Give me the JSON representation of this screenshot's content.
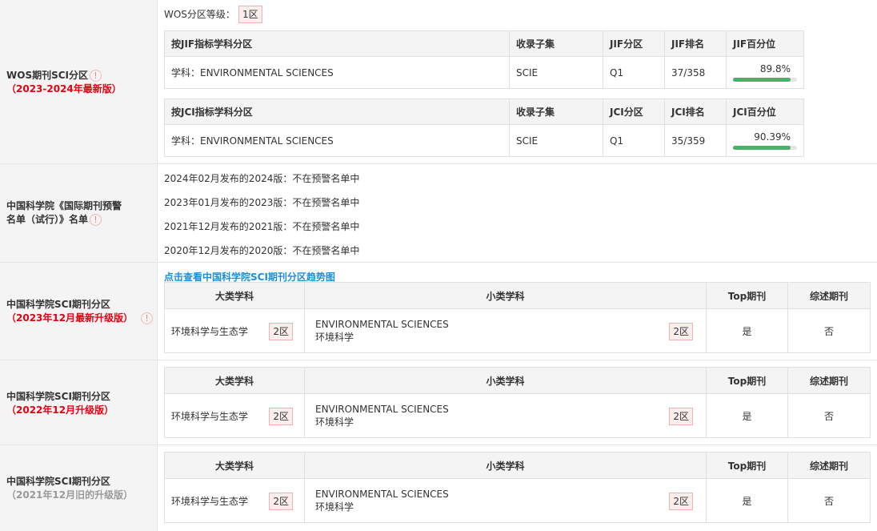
{
  "wos": {
    "label_line1": "WOS期刊SCI分区",
    "label_line2": "（2023-2024年最新版）",
    "level_label": "WOS分区等级：",
    "level_value": "1区",
    "jif_table": {
      "headers": [
        "按JIF指标学科分区",
        "收录子集",
        "JIF分区",
        "JIF排名",
        "JIF百分位"
      ],
      "row": {
        "subject": "学科：ENVIRONMENTAL SCIENCES",
        "subset": "SCIE",
        "quartile": "Q1",
        "rank": "37/358",
        "percentile": "89.8%",
        "percentile_value": 89.8
      }
    },
    "jci_table": {
      "headers": [
        "按JCI指标学科分区",
        "收录子集",
        "JCI分区",
        "JCI排名",
        "JCI百分位"
      ],
      "row": {
        "subject": "学科：ENVIRONMENTAL SCIENCES",
        "subset": "SCIE",
        "quartile": "Q1",
        "rank": "35/359",
        "percentile": "90.39%",
        "percentile_value": 90.39
      }
    }
  },
  "warning": {
    "label_line1": "中国科学院《国际期刊预警",
    "label_line2": "名单（试行）》名单",
    "items": [
      "2024年02月发布的2024版：不在预警名单中",
      "2023年01月发布的2023版：不在预警名单中",
      "2021年12月发布的2021版：不在预警名单中",
      "2020年12月发布的2020版：不在预警名单中"
    ]
  },
  "cas_tables": [
    {
      "label_line1": "中国科学院SCI期刊分区",
      "label_line2": "（2023年12月最新升级版）",
      "trend_link": "点击查看中国科学院SCI期刊分区趋势图",
      "headers": [
        "大类学科",
        "小类学科",
        "Top期刊",
        "综述期刊"
      ],
      "big_subject": "环境科学与生态学",
      "big_zone": "2区",
      "small_subject_en": "ENVIRONMENTAL SCIENCES",
      "small_subject_cn": "环境科学",
      "small_zone": "2区",
      "top": "是",
      "review": "否"
    },
    {
      "label_line1": "中国科学院SCI期刊分区",
      "label_line2": "（2022年12月升级版）",
      "headers": [
        "大类学科",
        "小类学科",
        "Top期刊",
        "综述期刊"
      ],
      "big_subject": "环境科学与生态学",
      "big_zone": "2区",
      "small_subject_en": "ENVIRONMENTAL SCIENCES",
      "small_subject_cn": "环境科学",
      "small_zone": "2区",
      "top": "是",
      "review": "否"
    },
    {
      "label_line1": "中国科学院SCI期刊分区",
      "label_line2": "（2021年12月旧的升级版）",
      "headers": [
        "大类学科",
        "小类学科",
        "Top期刊",
        "综述期刊"
      ],
      "big_subject": "环境科学与生态学",
      "big_zone": "2区",
      "small_subject_en": "ENVIRONMENTAL SCIENCES",
      "small_subject_cn": "环境科学",
      "small_zone": "2区",
      "top": "是",
      "review": "否"
    }
  ],
  "icons": {
    "info": "info-circle-icon"
  },
  "colors": {
    "accent_red": "#e60012",
    "link_blue": "#1a8fd8",
    "bar_green": "#4caf6a"
  }
}
